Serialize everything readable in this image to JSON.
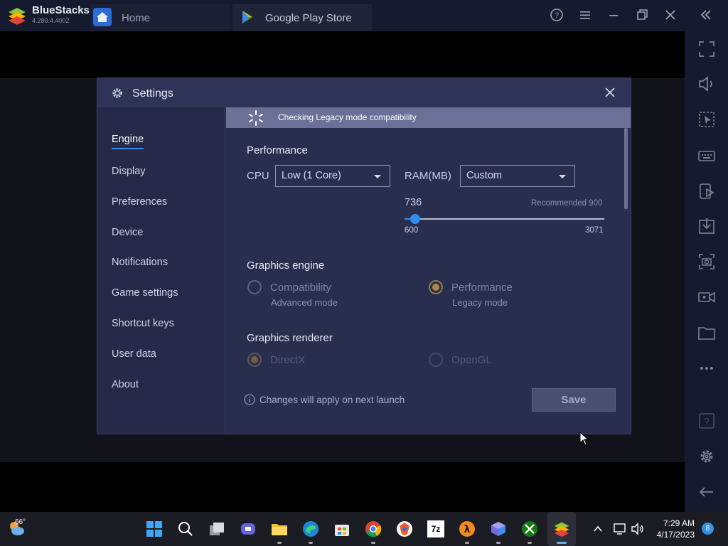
{
  "titlebar": {
    "app_name": "BlueStacks",
    "app_version": "4.280.4.4002",
    "tabs": [
      {
        "label": "Home"
      },
      {
        "label": "Google Play Store"
      }
    ]
  },
  "settings": {
    "title": "Settings",
    "nav": [
      "Engine",
      "Display",
      "Preferences",
      "Device",
      "Notifications",
      "Game settings",
      "Shortcut keys",
      "User data",
      "About"
    ],
    "active_nav": "Engine",
    "banner": "Checking Legacy mode compatibility",
    "performance": {
      "title": "Performance",
      "cpu_label": "CPU",
      "cpu_value": "Low (1 Core)",
      "ram_label": "RAM(MB)",
      "ram_value": "Custom",
      "ram_current": "736",
      "recommended": "Recommended 900",
      "slider_min": "600",
      "slider_max": "3071",
      "slider_fraction": 0.055
    },
    "graphics_engine": {
      "title": "Graphics engine",
      "opt1_label": "Compatibility",
      "opt1_sub": "Advanced mode",
      "opt2_label": "Performance",
      "opt2_sub": "Legacy mode",
      "selected": "Performance"
    },
    "graphics_renderer": {
      "title": "Graphics renderer",
      "opt1_label": "DirectX",
      "opt2_label": "OpenGL",
      "selected": "DirectX"
    },
    "footer_note": "Changes will apply on next launch",
    "save_label": "Save"
  },
  "taskbar": {
    "weather": "66°",
    "time": "7:29 AM",
    "date": "4/17/2023",
    "notifications": "8",
    "sevenzip_label": "7z"
  },
  "colors": {
    "accent_blue": "#2d8ef0",
    "dialog_bg": "#2a2e4e",
    "banner_bg": "#6b7196",
    "radio_selected": "#b08a3c"
  }
}
